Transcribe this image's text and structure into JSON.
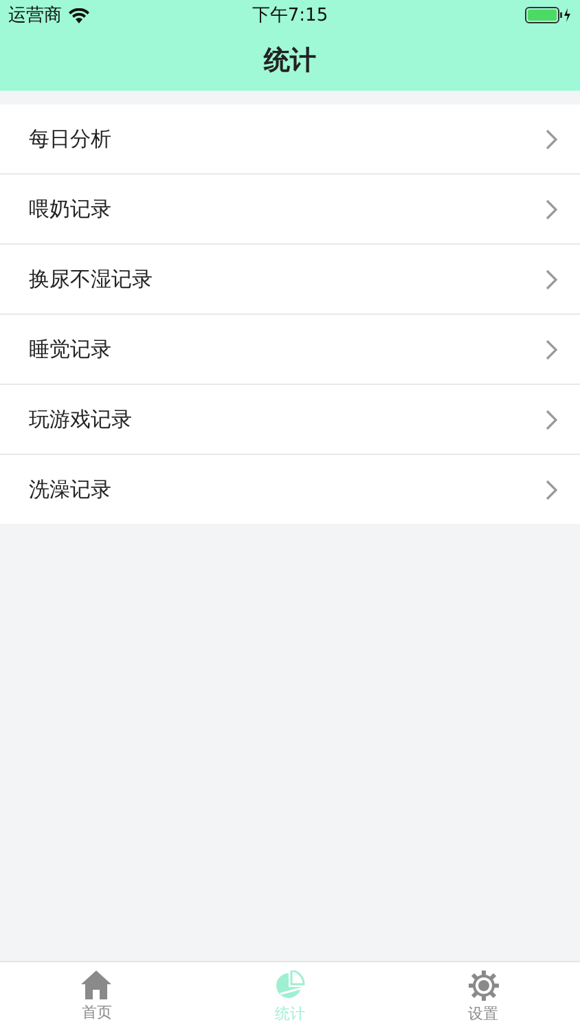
{
  "status_bar": {
    "carrier": "运营商",
    "time": "下午7:15"
  },
  "nav": {
    "title": "统计"
  },
  "items": [
    {
      "label": "每日分析"
    },
    {
      "label": "喂奶记录"
    },
    {
      "label": "换尿不湿记录"
    },
    {
      "label": "睡觉记录"
    },
    {
      "label": "玩游戏记录"
    },
    {
      "label": "洗澡记录"
    }
  ],
  "tabs": [
    {
      "label": "首页",
      "kind": "home",
      "selected": false
    },
    {
      "label": "统计",
      "kind": "stats",
      "selected": true
    },
    {
      "label": "设置",
      "kind": "settings",
      "selected": false
    }
  ]
}
